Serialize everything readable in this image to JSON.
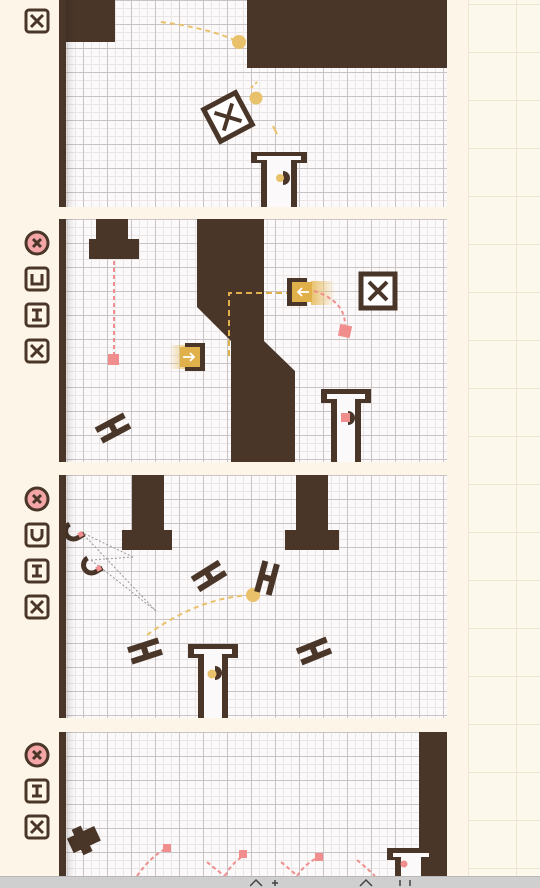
{
  "game": {
    "colors": {
      "wall": "#4a3629",
      "accent_yellow": "#e9c16a",
      "accent_pink": "#f08e8e",
      "paper": "#fdf6e8",
      "grid": "#c9c3c3"
    },
    "levels": [
      {
        "id": 1,
        "tools": [
          "crate-tool"
        ]
      },
      {
        "id": 2,
        "tools": [
          "clear-tool",
          "cup-tool",
          "h-block-tool",
          "crate-tool"
        ]
      },
      {
        "id": 3,
        "tools": [
          "clear-tool",
          "magnet-tool",
          "h-block-tool",
          "crate-tool"
        ]
      },
      {
        "id": 4,
        "tools": [
          "clear-tool",
          "h-block-tool",
          "crate-tool"
        ]
      }
    ]
  }
}
